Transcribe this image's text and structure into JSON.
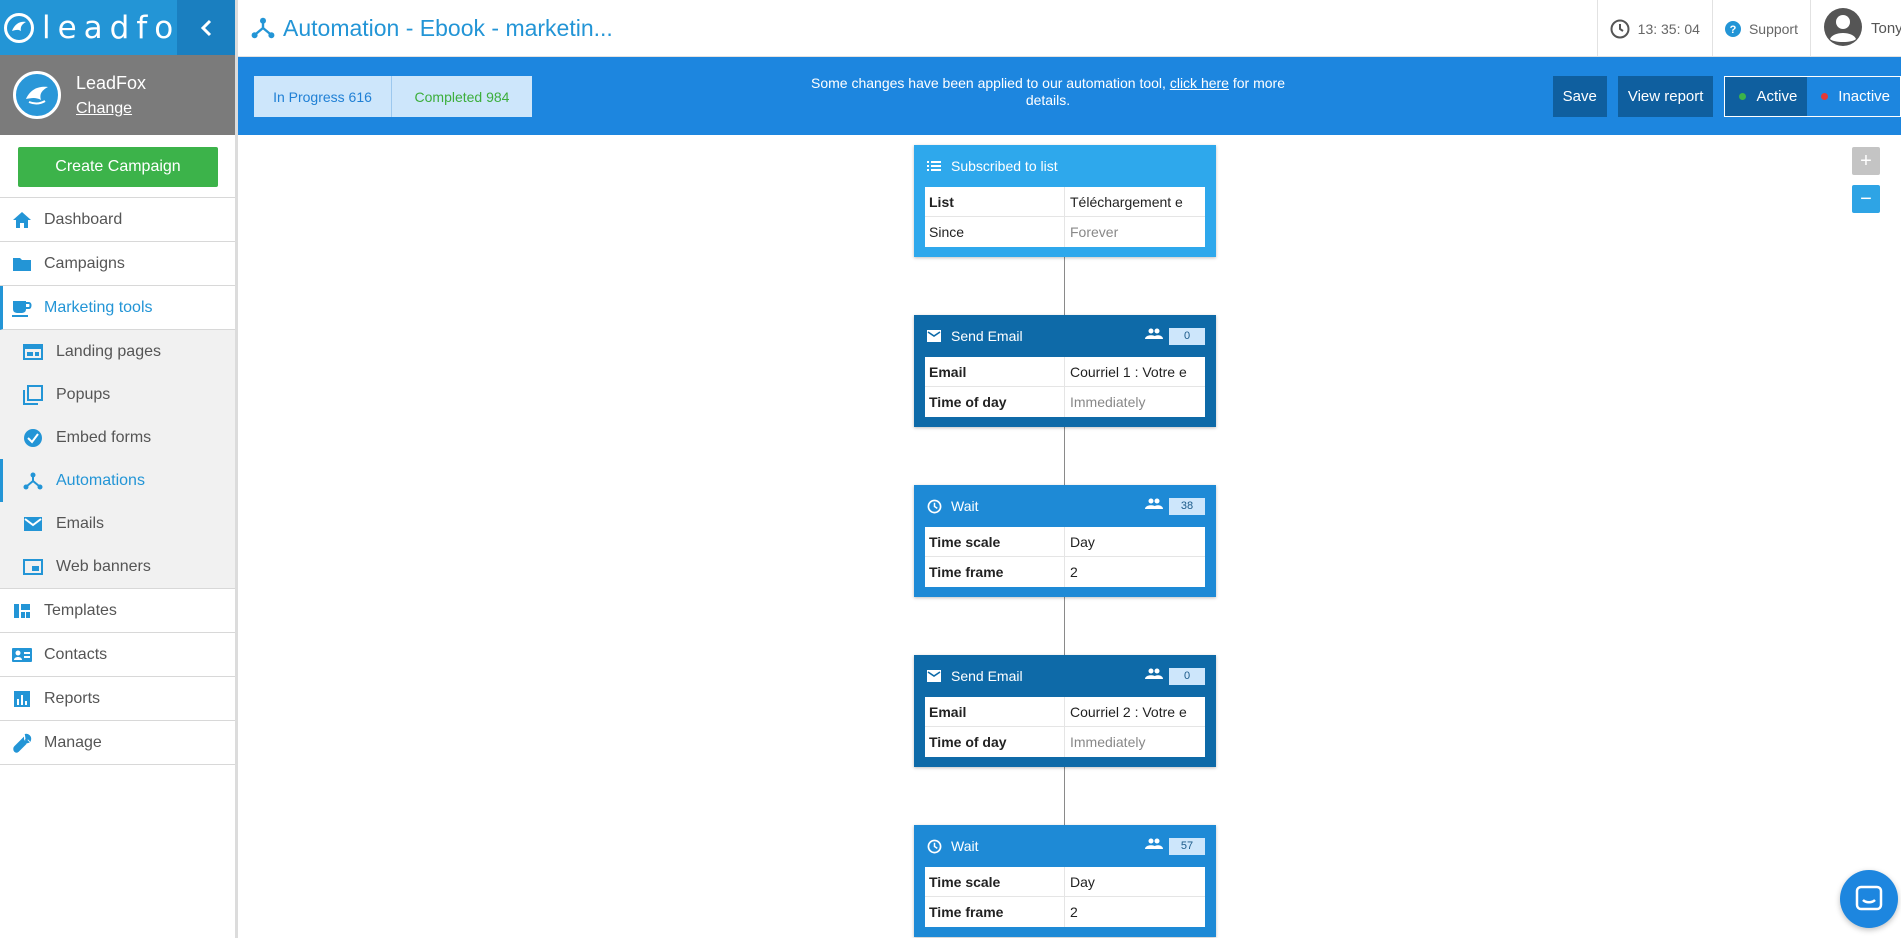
{
  "sidebar": {
    "logo_text": "leadfox",
    "account": {
      "name": "LeadFox",
      "change_label": "Change"
    },
    "create_label": "Create Campaign",
    "items": [
      {
        "label": "Dashboard",
        "icon": "home-icon"
      },
      {
        "label": "Campaigns",
        "icon": "folder-icon"
      },
      {
        "label": "Marketing tools",
        "icon": "coffee-icon",
        "active": true
      },
      {
        "label": "Templates",
        "icon": "grid-layout-icon"
      },
      {
        "label": "Contacts",
        "icon": "contacts-card-icon"
      },
      {
        "label": "Reports",
        "icon": "bar-chart-icon"
      },
      {
        "label": "Manage",
        "icon": "wrench-icon"
      }
    ],
    "subitems": [
      {
        "label": "Landing pages",
        "icon": "landing-page-icon"
      },
      {
        "label": "Popups",
        "icon": "popup-icon"
      },
      {
        "label": "Embed forms",
        "icon": "check-circle-icon"
      },
      {
        "label": "Automations",
        "icon": "automation-icon",
        "active": true
      },
      {
        "label": "Emails",
        "icon": "mail-icon"
      },
      {
        "label": "Web banners",
        "icon": "web-banner-icon"
      }
    ]
  },
  "header": {
    "title": "Automation - Ebook - marketin...",
    "clock": "13: 35: 04",
    "support_label": "Support",
    "user_name": "Tony"
  },
  "status": {
    "in_progress_label": "In Progress 616",
    "completed_label": "Completed 984",
    "notice_text": "Some changes have been applied to our automation tool, ",
    "notice_link": "click here",
    "notice_tail": " for more details.",
    "save_label": "Save",
    "view_report_label": "View report",
    "active_label": "Active",
    "inactive_label": "Inactive",
    "active_color": "#3cb34a",
    "inactive_color": "#e53935"
  },
  "flow": {
    "zoom_in": "+",
    "zoom_out": "−",
    "nodes": [
      {
        "type": "trigger",
        "title": "Subscribed to list",
        "rows": [
          {
            "key": "List",
            "value": "Téléchargement e"
          },
          {
            "key": "Since",
            "value": "Forever"
          }
        ]
      },
      {
        "type": "email",
        "title": "Send Email",
        "count": "0",
        "rows": [
          {
            "key": "Email",
            "value": "Courriel 1 : Votre e"
          },
          {
            "key": "Time of day",
            "value": "Immediately"
          }
        ]
      },
      {
        "type": "wait",
        "title": "Wait",
        "count": "38",
        "rows": [
          {
            "key": "Time scale",
            "value": "Day"
          },
          {
            "key": "Time frame",
            "value": "2"
          }
        ]
      },
      {
        "type": "email",
        "title": "Send Email",
        "count": "0",
        "rows": [
          {
            "key": "Email",
            "value": "Courriel 2 : Votre e"
          },
          {
            "key": "Time of day",
            "value": "Immediately"
          }
        ]
      },
      {
        "type": "wait",
        "title": "Wait",
        "count": "57",
        "rows": [
          {
            "key": "Time scale",
            "value": "Day"
          },
          {
            "key": "Time frame",
            "value": "2"
          }
        ]
      }
    ]
  }
}
